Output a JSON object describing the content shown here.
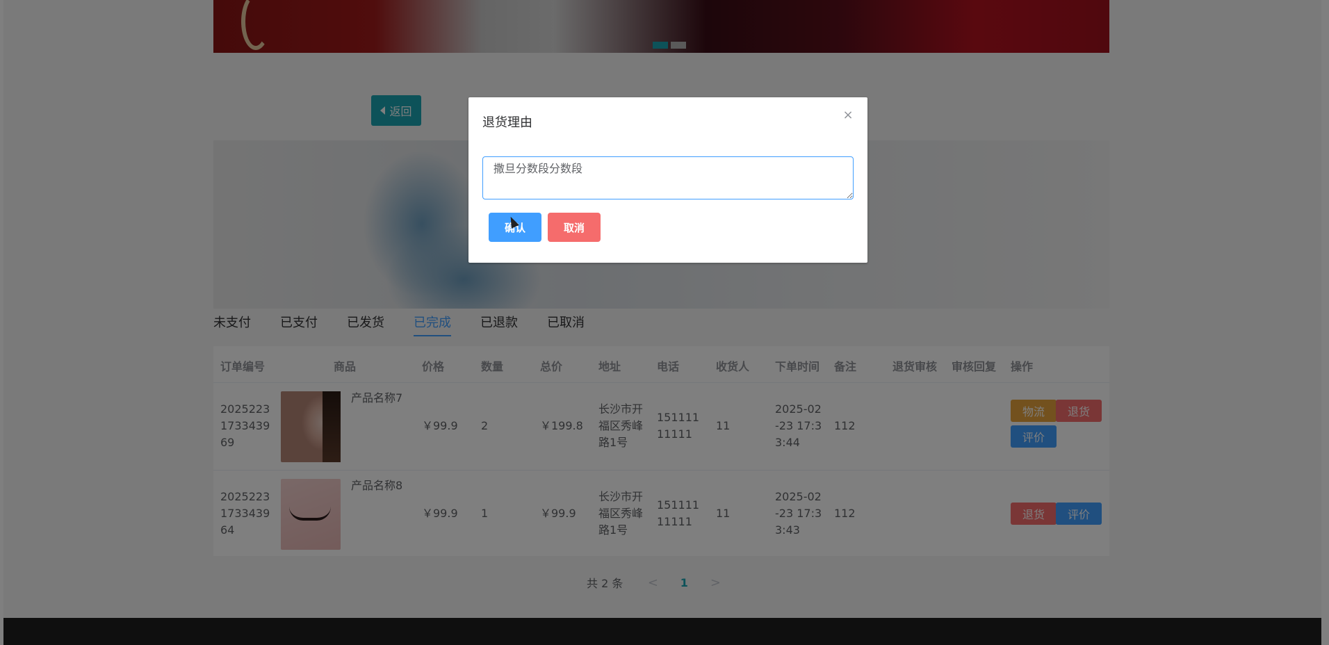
{
  "back_button": {
    "label": "返回"
  },
  "tabs": [
    {
      "label": "未支付"
    },
    {
      "label": "已支付"
    },
    {
      "label": "已发货"
    },
    {
      "label": "已完成"
    },
    {
      "label": "已退款"
    },
    {
      "label": "已取消"
    }
  ],
  "active_tab": "已完成",
  "table": {
    "headers": [
      "订单编号",
      "商品",
      "价格",
      "数量",
      "总价",
      "地址",
      "电话",
      "收货人",
      "下单时间",
      "备注",
      "退货审核",
      "审核回复",
      "操作"
    ],
    "rows": [
      {
        "order_id": "2025223\n1733439\n69",
        "product_name": "产品名称7",
        "price": "￥99.9",
        "quantity": "2",
        "total": "￥199.8",
        "address": "长沙市开\n福区秀峰\n路1号",
        "phone": "151111\n11111",
        "receiver": "11",
        "order_time": "2025-02\n-23 17:3\n3:44",
        "remark": "112",
        "actions": [
          "物流",
          "退货",
          "评价"
        ]
      },
      {
        "order_id": "2025223\n1733439\n64",
        "product_name": "产品名称8",
        "price": "￥99.9",
        "quantity": "1",
        "total": "￥99.9",
        "address": "长沙市开\n福区秀峰\n路1号",
        "phone": "151111\n11111",
        "receiver": "11",
        "order_time": "2025-02\n-23 17:3\n3:43",
        "remark": "112",
        "actions": [
          "退货",
          "评价"
        ]
      }
    ]
  },
  "pagination": {
    "total_text": "共 2 条",
    "prev": "<",
    "current_page": "1",
    "next": ">"
  },
  "dialog": {
    "title": "退货理由",
    "close": "×",
    "textarea_value": "撒旦分数段分数段",
    "confirm_label": "确认",
    "cancel_label": "取消"
  },
  "colors": {
    "primary": "#409eff",
    "danger": "#f56c6c",
    "warning": "#e6a23c",
    "teal": "#1aa5b3"
  }
}
